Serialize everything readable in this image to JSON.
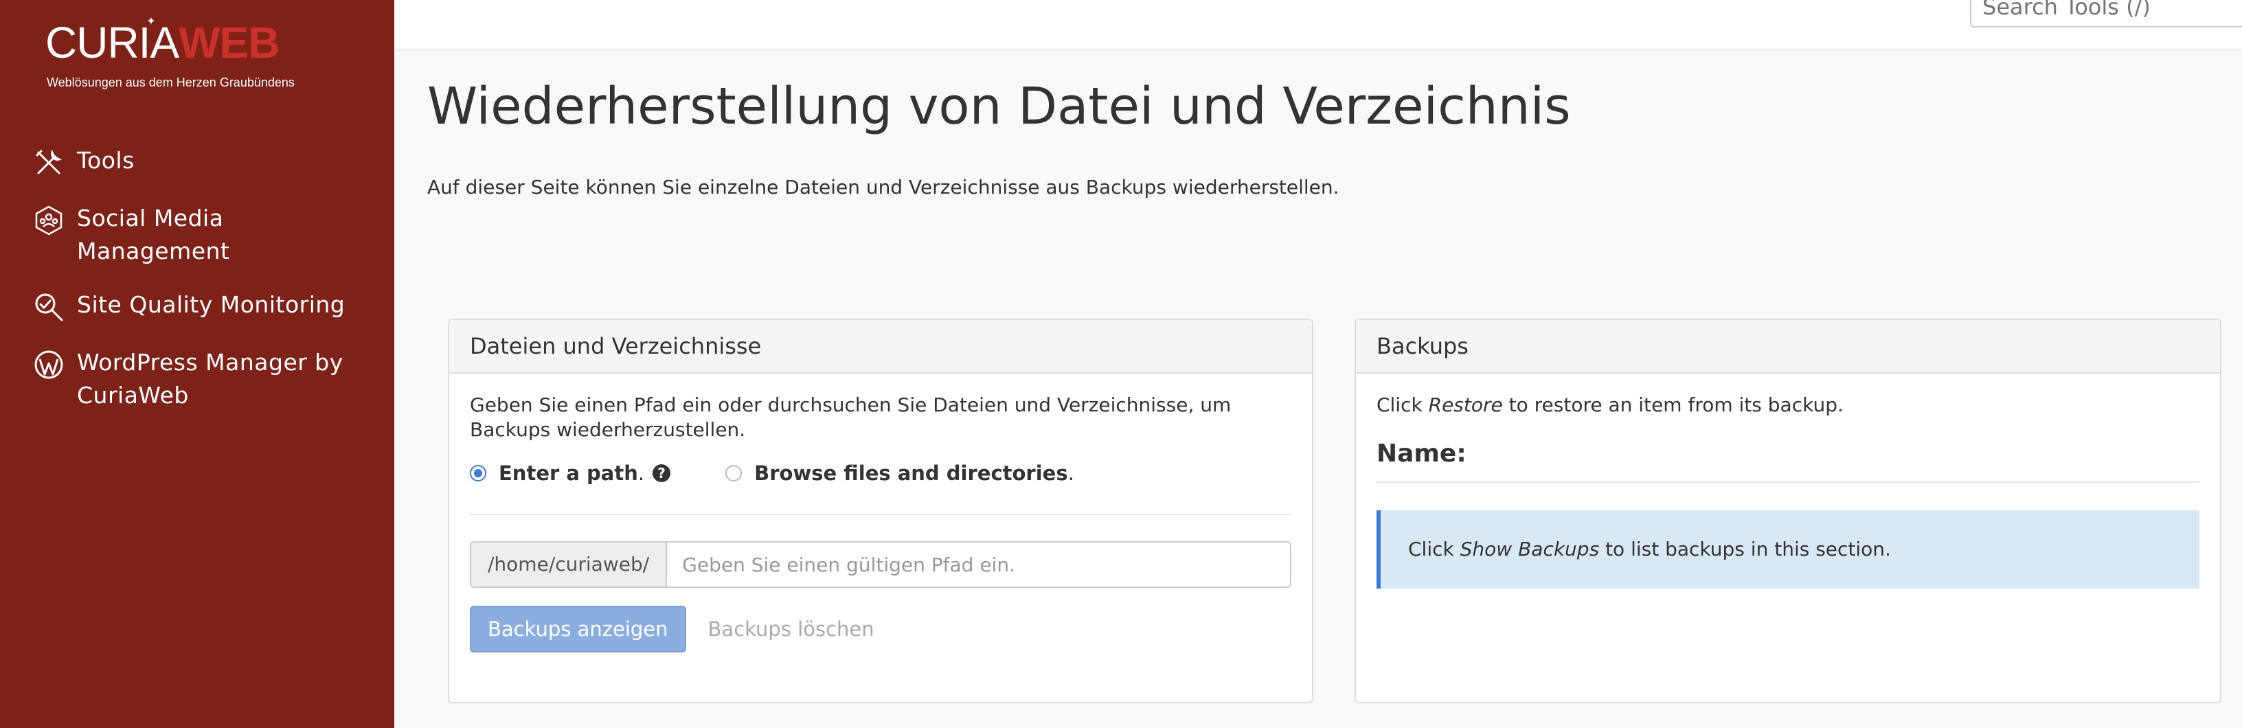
{
  "brand": {
    "logo_part1": "CURIA",
    "logo_part2": "WEB",
    "tagline": "Weblösungen aus dem Herzen Graubündens"
  },
  "sidebar": {
    "items": [
      {
        "label": "Tools",
        "icon": "tools-icon"
      },
      {
        "label": "Social Media Management",
        "icon": "social-media-icon"
      },
      {
        "label": "Site Quality Monitoring",
        "icon": "magnifier-icon"
      },
      {
        "label": "WordPress Manager by CuriaWeb",
        "icon": "wordpress-icon"
      }
    ]
  },
  "search": {
    "placeholder": "Search Tools (/)"
  },
  "page": {
    "title": "Wiederherstellung von Datei und Verzeichnis",
    "description": "Auf dieser Seite können Sie einzelne Dateien und Verzeichnisse aus Backups wiederherstellen."
  },
  "files_panel": {
    "header": "Dateien und Verzeichnisse",
    "instructions": "Geben Sie einen Pfad ein oder durchsuchen Sie Dateien und Verzeichnisse, um Backups wiederherzustellen.",
    "option_path": "Enter a path",
    "option_browse": "Browse files and directories",
    "option_suffix": ".",
    "help_symbol": "?",
    "path_prefix": "/home/curiaweb/",
    "path_placeholder": "Geben Sie einen gültigen Pfad ein.",
    "path_value": "",
    "show_backups_label": "Backups anzeigen",
    "clear_backups_label": "Backups löschen"
  },
  "backups_panel": {
    "header": "Backups",
    "hint_pre": "Click ",
    "hint_em": "Restore",
    "hint_post": " to restore an item from its backup.",
    "name_label": "Name:",
    "info_pre": "Click ",
    "info_em": "Show Backups",
    "info_post": " to list backups in this section."
  },
  "colors": {
    "sidebar_bg": "#7e2117",
    "accent": "#3a7bd5",
    "button_bg": "#8aaee0",
    "info_bg": "#d9e8f5"
  }
}
